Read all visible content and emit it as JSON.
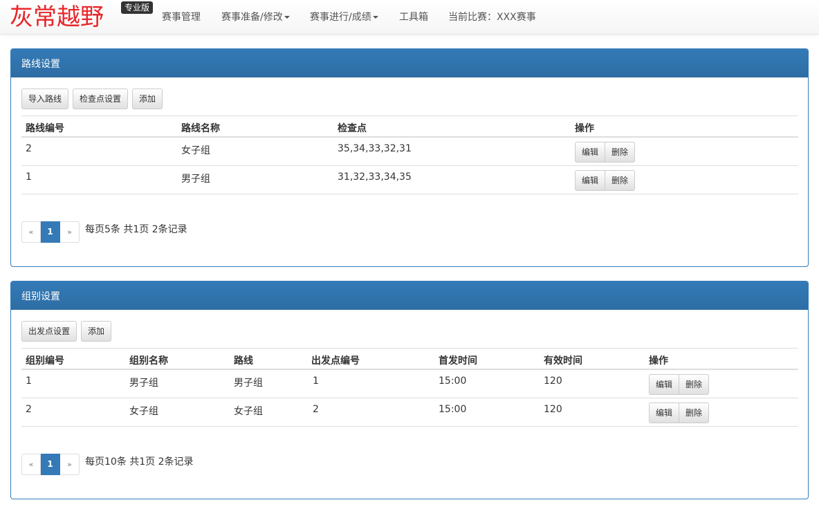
{
  "navbar": {
    "brand": "灰常越野",
    "edition": "专业版",
    "items": [
      {
        "label": "赛事管理"
      },
      {
        "label": "赛事准备/修改"
      },
      {
        "label": "赛事进行/成绩"
      },
      {
        "label": "工具箱"
      },
      {
        "label": "当前比赛：XXX赛事"
      }
    ]
  },
  "routes": {
    "title": "路线设置",
    "buttons": {
      "import": "导入路线",
      "checkpoints": "检查点设置",
      "add": "添加"
    },
    "columns": [
      "路线编号",
      "路线名称",
      "检查点",
      "操作"
    ],
    "rows": [
      {
        "id": "2",
        "name": "女子组",
        "checkpoints": "35,34,33,32,31"
      },
      {
        "id": "1",
        "name": "男子组",
        "checkpoints": "31,32,33,34,35"
      }
    ],
    "row_actions": {
      "edit": "编辑",
      "delete": "删除"
    },
    "pager": {
      "prev": "«",
      "page": "1",
      "next": "»",
      "info": "每页5条 共1页 2条记录"
    }
  },
  "groups": {
    "title": "组别设置",
    "buttons": {
      "start_points": "出发点设置",
      "add": "添加"
    },
    "columns": [
      "组别编号",
      "组别名称",
      "路线",
      "出发点编号",
      "首发时间",
      "有效时间",
      "操作"
    ],
    "rows": [
      {
        "id": "1",
        "name": "男子组",
        "route": "男子组",
        "start_point": "1",
        "first_start": "15:00",
        "valid_time": "120"
      },
      {
        "id": "2",
        "name": "女子组",
        "route": "女子组",
        "start_point": "2",
        "first_start": "15:00",
        "valid_time": "120"
      }
    ],
    "row_actions": {
      "edit": "编辑",
      "delete": "删除"
    },
    "pager": {
      "prev": "«",
      "page": "1",
      "next": "»",
      "info": "每页10条 共1页 2条记录"
    }
  }
}
